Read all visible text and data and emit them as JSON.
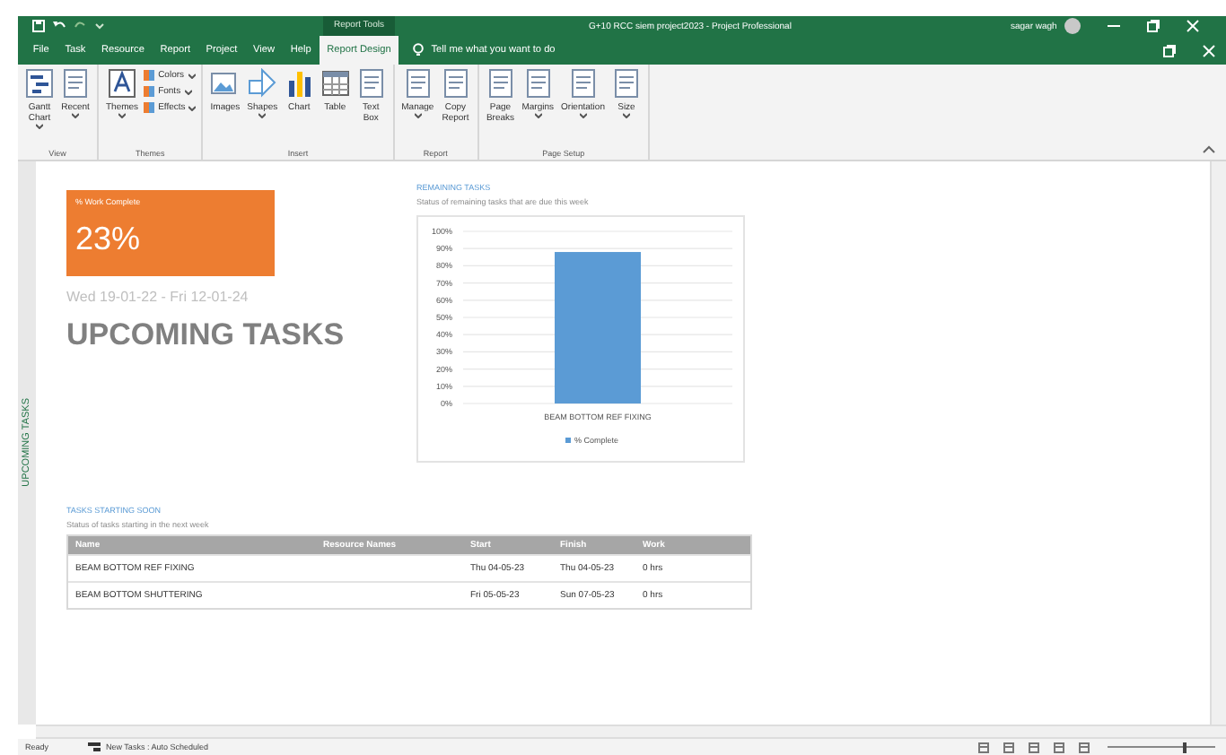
{
  "title_bar": {
    "contextual_tab": "Report Tools",
    "title": "G+10 RCC siem project2023  -  Project Professional",
    "user": "sagar wagh"
  },
  "tabs": [
    {
      "label": "File",
      "selected": false
    },
    {
      "label": "Task",
      "selected": false
    },
    {
      "label": "Resource",
      "selected": false
    },
    {
      "label": "Report",
      "selected": false
    },
    {
      "label": "Project",
      "selected": false
    },
    {
      "label": "View",
      "selected": false
    },
    {
      "label": "Help",
      "selected": false
    },
    {
      "label": "Report Design",
      "selected": true
    }
  ],
  "tell_me": {
    "placeholder": "Tell me what you want to do"
  },
  "ribbon": [
    {
      "group": "View",
      "commands": [
        {
          "label": "Gantt\nChart",
          "kind": "large",
          "dropdown": true
        },
        {
          "label": "Recent",
          "kind": "large",
          "dropdown": true
        }
      ]
    },
    {
      "group": "Themes",
      "commands": [
        {
          "label": "Themes",
          "kind": "large",
          "dropdown": true
        },
        {
          "label": "Colors",
          "kind": "small",
          "dropdown": true
        },
        {
          "label": "Fonts",
          "kind": "small",
          "dropdown": true
        },
        {
          "label": "Effects",
          "kind": "small",
          "dropdown": true
        }
      ]
    },
    {
      "group": "Insert",
      "commands": [
        {
          "label": "Images",
          "kind": "large",
          "dropdown": false
        },
        {
          "label": "Shapes",
          "kind": "large",
          "dropdown": true
        },
        {
          "label": "Chart",
          "kind": "large",
          "dropdown": false
        },
        {
          "label": "Table",
          "kind": "large",
          "dropdown": false
        },
        {
          "label": "Text\nBox",
          "kind": "large",
          "dropdown": false
        }
      ]
    },
    {
      "group": "Report",
      "commands": [
        {
          "label": "Manage",
          "kind": "large",
          "dropdown": true
        },
        {
          "label": "Copy\nReport",
          "kind": "large",
          "dropdown": false
        }
      ]
    },
    {
      "group": "Page Setup",
      "commands": [
        {
          "label": "Page\nBreaks",
          "kind": "large",
          "dropdown": false
        },
        {
          "label": "Margins",
          "kind": "large",
          "dropdown": true
        },
        {
          "label": "Orientation",
          "kind": "large",
          "dropdown": true
        },
        {
          "label": "Size",
          "kind": "large",
          "dropdown": true
        }
      ]
    }
  ],
  "side_label": "UPCOMING TASKS",
  "report": {
    "kpi": {
      "label": "% Work Complete",
      "value": "23%"
    },
    "date_range": "Wed 19-01-22 -  Fri 12-01-24",
    "heading": "UPCOMING TASKS",
    "remaining": {
      "title": "REMAINING TASKS",
      "subtitle": "Status of remaining tasks that are due this week",
      "chart_data": {
        "type": "bar",
        "categories": [
          "BEAM BOTTOM REF FIXING"
        ],
        "series": [
          {
            "name": "% Complete",
            "color": "#5b9bd5",
            "values": [
              88
            ]
          }
        ],
        "ylim": [
          0,
          100
        ],
        "grid": true,
        "yticks": [
          {
            "value": 0,
            "label": "0%"
          },
          {
            "value": 10,
            "label": "10%"
          },
          {
            "value": 20,
            "label": "20%"
          },
          {
            "value": 30,
            "label": "30%"
          },
          {
            "value": 40,
            "label": "40%"
          },
          {
            "value": 50,
            "label": "50%"
          },
          {
            "value": 60,
            "label": "60%"
          },
          {
            "value": 70,
            "label": "70%"
          },
          {
            "value": 80,
            "label": "80%"
          },
          {
            "value": 90,
            "label": "90%"
          },
          {
            "value": 100,
            "label": "100%"
          }
        ]
      }
    },
    "starting": {
      "title": "TASKS STARTING SOON",
      "subtitle": "Status of tasks starting in the next week",
      "columns": [
        "Name",
        "Resource Names",
        "Start",
        "Finish",
        "Work"
      ],
      "rows": [
        [
          "BEAM BOTTOM REF FIXING",
          "",
          "Thu 04-05-23",
          "Thu 04-05-23",
          "0 hrs"
        ],
        [
          "BEAM BOTTOM SHUTTERING",
          "",
          "Fri 05-05-23",
          "Sun 07-05-23",
          "0 hrs"
        ]
      ]
    }
  },
  "status_bar": {
    "state": "Ready",
    "task_mode": "New Tasks : Auto Scheduled",
    "zoom": {
      "level": 0.72
    }
  }
}
